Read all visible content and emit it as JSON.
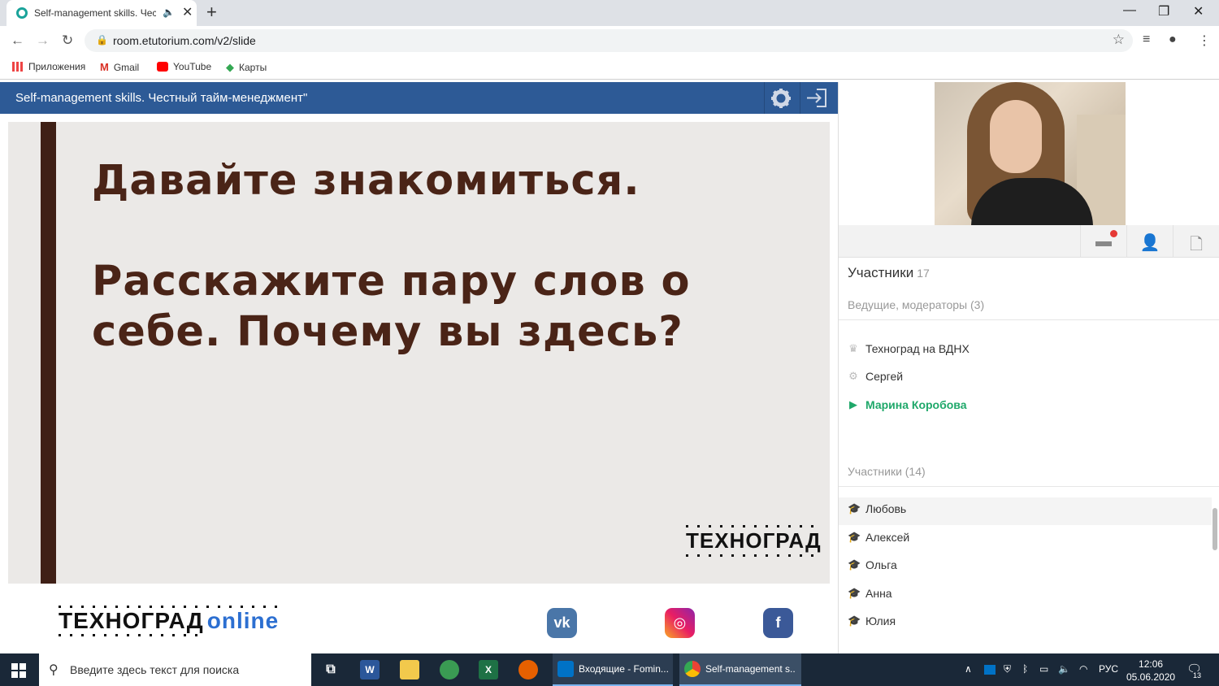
{
  "browser": {
    "tab_title": "Self-management skills. Чест",
    "new_tab_symbol": "+",
    "url": "room.etutorium.com/v2/slide",
    "bookmarks": [
      "Приложения",
      "Gmail",
      "YouTube",
      "Карты"
    ]
  },
  "app": {
    "header_title": "Self-management skills. Честный тайм-менеджмент\"",
    "slide": {
      "heading": "Давайте знакомиться.",
      "body": "Расскажите пару слов о себе. Почему вы здесь?",
      "logo": "ТЕХНОГРАД"
    },
    "footer": {
      "logo_text": "ТЕХНОГРАД",
      "logo_suffix": "online",
      "social": [
        "vk-icon",
        "instagram-icon",
        "facebook-icon"
      ]
    }
  },
  "panel": {
    "title": "Участники",
    "title_count": "17",
    "hosts_label": "Ведущие, модераторы (3)",
    "hosts": [
      {
        "name": "Техноград на ВДНХ",
        "icon": "crown-icon"
      },
      {
        "name": "Сергей",
        "icon": "gear-icon"
      },
      {
        "name": "Марина Коробова",
        "icon": "play-icon"
      }
    ],
    "participants_label": "Участники (14)",
    "participants": [
      "Любовь",
      "Алексей",
      "Ольга",
      "Анна",
      "Юлия"
    ]
  },
  "taskbar": {
    "search_placeholder": "Введите здесь текст для поиска",
    "outlook_label": "Входящие - Fomin...",
    "chrome_label": "Self-management s...",
    "lang": "РУС",
    "time": "12:06",
    "date": "05.06.2020",
    "notifications": "13"
  },
  "colors": {
    "header_blue": "#2d5a96",
    "slide_bg": "#ebe9e7",
    "slide_text": "#4a2417",
    "speaker_green": "#1fa86a",
    "online_blue": "#2c6fd1"
  }
}
